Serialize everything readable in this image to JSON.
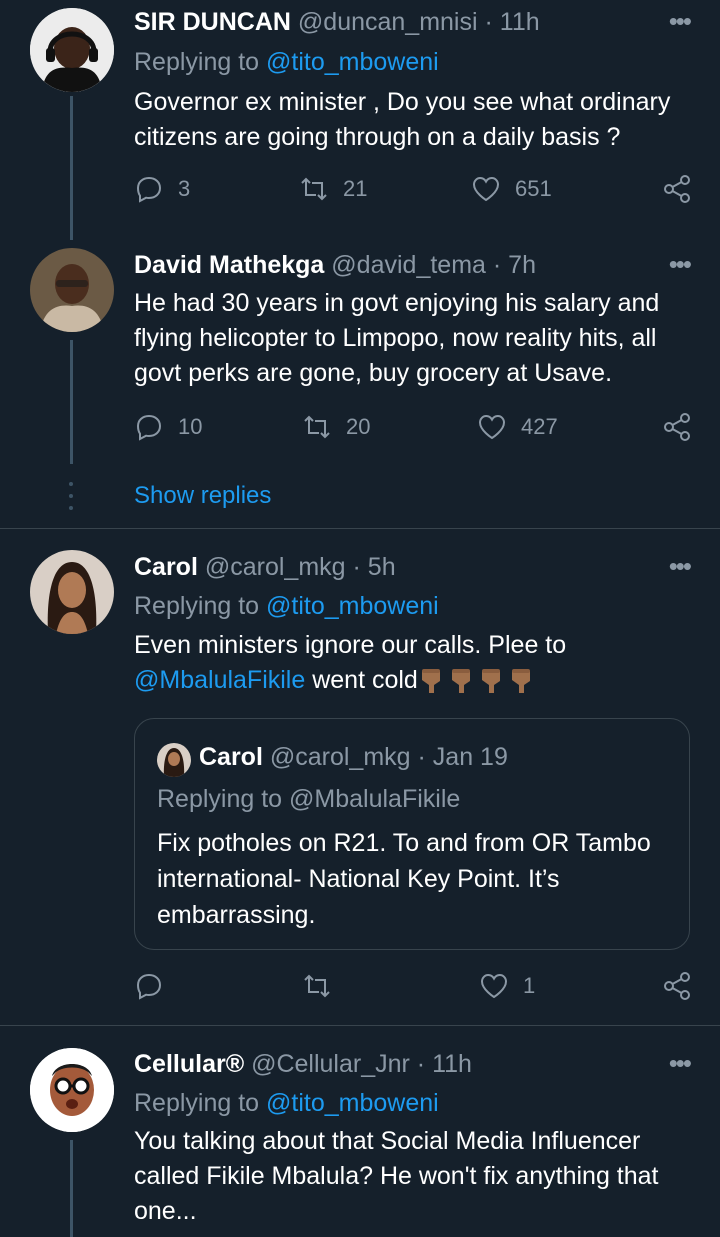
{
  "tweets": [
    {
      "name": "SIR DUNCAN",
      "handle": "@duncan_mnisi",
      "time": "· 11h",
      "reply_prefix": "Replying to ",
      "reply_to": "@tito_mboweni",
      "text": "Governor ex minister , Do you see what ordinary citizens are going through on a daily basis ?",
      "replies": "3",
      "retweets": "21",
      "likes": "651",
      "avatar_icon": "man-with-headphones-avatar"
    },
    {
      "name": "David Mathekga",
      "handle": "@david_tema",
      "time": "· 7h",
      "text": "He had 30 years in govt enjoying his salary and flying helicopter to Limpopo, now reality hits, all govt perks are gone, buy grocery at Usave.",
      "replies": "10",
      "retweets": "20",
      "likes": "427",
      "avatar_icon": "man-with-scarf-avatar"
    },
    {
      "name": "Carol",
      "handle": "@carol_mkg",
      "time": "· 5h",
      "reply_prefix": "Replying to ",
      "reply_to": "@tito_mboweni",
      "text_before": "Even ministers ignore our calls. Plee to ",
      "text_mention": "@MbalulaFikile",
      "text_after": " went cold",
      "emoji_name": "backhand-index-pointing-down-medium-dark-skin-tone",
      "likes": "1",
      "avatar_icon": "woman-portrait-avatar",
      "quote": {
        "name": "Carol",
        "handle": "@carol_mkg",
        "time": "· Jan 19",
        "reply_line": "Replying to @MbalulaFikile",
        "text": "Fix potholes on R21. To and from OR Tambo international- National Key Point. It’s embarrassing."
      }
    },
    {
      "name": "Cellular®",
      "handle": "@Cellular_Jnr",
      "time": "· 11h",
      "reply_prefix": "Replying to ",
      "reply_to": "@tito_mboweni",
      "text": "You talking about that Social Media Influencer called Fikile Mbalula? He won't fix anything that one...",
      "avatar_icon": "cartoon-man-glasses-avatar"
    }
  ],
  "show_replies": "Show replies",
  "more_icon": "more-options-icon",
  "colors": {
    "background": "#15202b",
    "text": "#ffffff",
    "secondary": "#8b98a5",
    "link": "#1d9bf0",
    "divider": "#38444d"
  }
}
